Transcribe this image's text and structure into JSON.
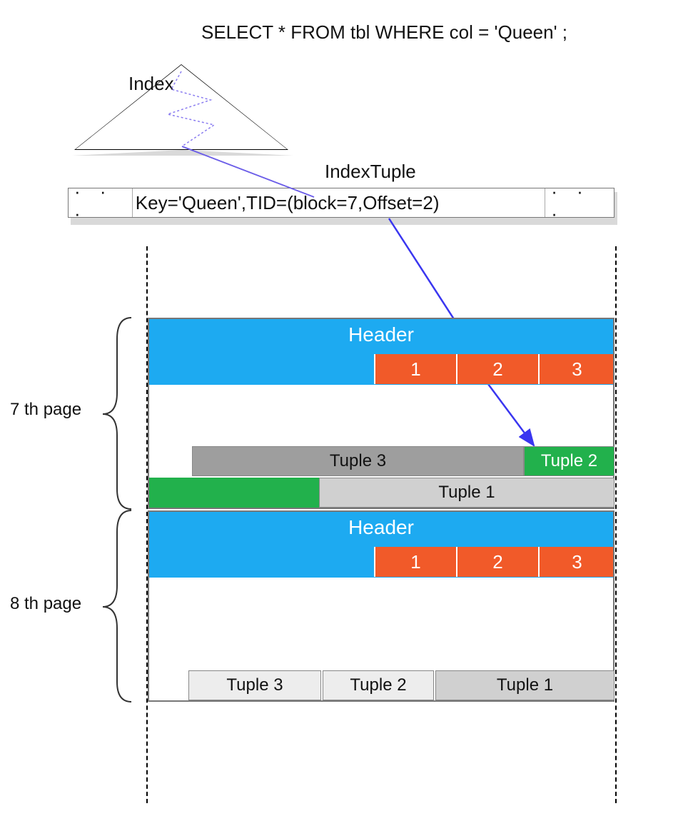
{
  "sql": "SELECT * FROM tbl WHERE  col = 'Queen' ;",
  "index_label": "Index",
  "indextuple_label": "IndexTuple",
  "indextuple_cells": {
    "left_dots": "·   ·   ·",
    "main": "Key='Queen',TID=(block=7,Offset=2)",
    "right_dots": "·   ·   ·"
  },
  "pages": [
    {
      "label": "7 th page",
      "header": "Header",
      "slots": [
        "1",
        "2",
        "3"
      ],
      "tuples": {
        "t3": "Tuple 3",
        "t2": "Tuple 2",
        "t1": "Tuple 1"
      }
    },
    {
      "label": "8 th page",
      "header": "Header",
      "slots": [
        "1",
        "2",
        "3"
      ],
      "tuples": {
        "t3": "Tuple 3",
        "t2": "Tuple 2",
        "t1": "Tuple 1"
      }
    }
  ],
  "colors": {
    "header": "#1daaf1",
    "slot": "#f15a29",
    "green": "#22B14C",
    "grey": "#9e9e9e",
    "lightgrey": "#d0d0d0",
    "verylight": "#ededed",
    "arrow": "#3a36f0"
  }
}
